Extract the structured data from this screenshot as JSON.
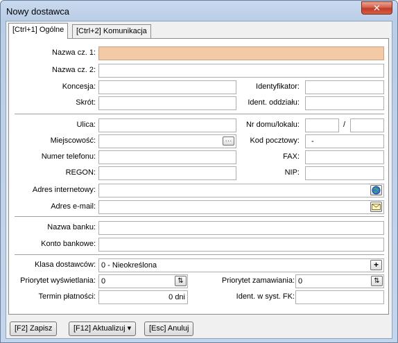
{
  "window": {
    "title": "Nowy dostawca",
    "close_glyph": "✕"
  },
  "tabs": [
    {
      "label": "[Ctrl+1] Ogólne"
    },
    {
      "label": "[Ctrl+2] Komunikacja"
    }
  ],
  "form": {
    "nazwa1": {
      "label": "Nazwa cz. 1:",
      "value": ""
    },
    "nazwa2": {
      "label": "Nazwa cz. 2:",
      "value": ""
    },
    "koncesja": {
      "label": "Koncesja:",
      "value": ""
    },
    "identyfikator": {
      "label": "Identyfikator:",
      "value": ""
    },
    "skrot": {
      "label": "Skrót:",
      "value": ""
    },
    "ident_oddzialu": {
      "label": "Ident. oddziału:",
      "value": ""
    },
    "ulica": {
      "label": "Ulica:",
      "value": ""
    },
    "nr_domu": {
      "label": "Nr domu/lokalu:",
      "value": "",
      "separator": "/",
      "value2": ""
    },
    "miejscowosc": {
      "label": "Miejscowość:",
      "value": ""
    },
    "kod_pocztowy": {
      "label": "Kod pocztowy:",
      "value": "-"
    },
    "telefon": {
      "label": "Numer telefonu:",
      "value": ""
    },
    "fax": {
      "label": "FAX:",
      "value": ""
    },
    "regon": {
      "label": "REGON:",
      "value": ""
    },
    "nip": {
      "label": "NIP:",
      "value": ""
    },
    "www": {
      "label": "Adres internetowy:",
      "value": ""
    },
    "email": {
      "label": "Adres e-mail:",
      "value": ""
    },
    "bank": {
      "label": "Nazwa banku:",
      "value": ""
    },
    "konto": {
      "label": "Konto bankowe:",
      "value": ""
    },
    "klasa": {
      "label": "Klasa dostawców:",
      "value": "0 - Nieokreślona"
    },
    "prio_wysw": {
      "label": "Priorytet wyświetlania:",
      "value": "0"
    },
    "prio_zam": {
      "label": "Priorytet zamawiania:",
      "value": "0"
    },
    "termin": {
      "label": "Termin płatności:",
      "value": "0 dni"
    },
    "ident_fk": {
      "label": "Ident. w syst. FK:",
      "value": ""
    }
  },
  "buttons": {
    "zapisz": "[F2] Zapisz",
    "aktualizuj": "[F12] Aktualizuj ▾",
    "anuluj": "[Esc] Anuluj",
    "ellipsis": "···",
    "plus": "+",
    "spin": "⇅"
  },
  "colors": {
    "highlight_field": "#f4c9a6",
    "close_button": "#c0392b"
  }
}
